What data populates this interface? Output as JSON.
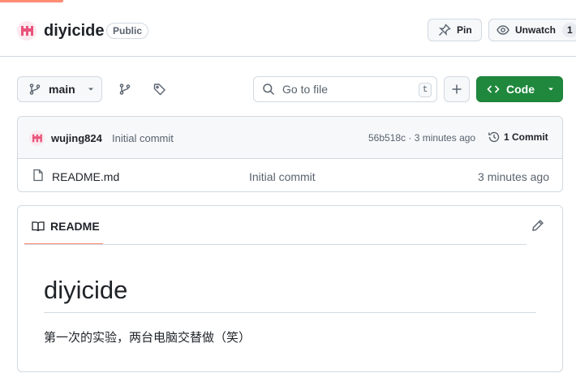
{
  "repo": {
    "name": "diyicide",
    "visibility": "Public"
  },
  "header": {
    "pin_label": "Pin",
    "unwatch_label": "Unwatch",
    "watch_count": "1"
  },
  "toolbar": {
    "branch": "main",
    "goto_placeholder": "Go to file",
    "goto_shortcut": "t",
    "code_label": "Code"
  },
  "latest_commit": {
    "author": "wujing824",
    "message": "Initial commit",
    "meta": "56b518c · 3 minutes ago",
    "commits_label": "1 Commit"
  },
  "files": [
    {
      "name": "README.md",
      "commit": "Initial commit",
      "time": "3 minutes ago"
    }
  ],
  "readme": {
    "tab_label": "README",
    "heading": "diyicide",
    "body": "第一次的实验，两台电脑交替做（笑）"
  },
  "icons": {
    "avatar_color": "#e8537a",
    "accent": "#fd8c73",
    "code_button": "#1f883d"
  }
}
